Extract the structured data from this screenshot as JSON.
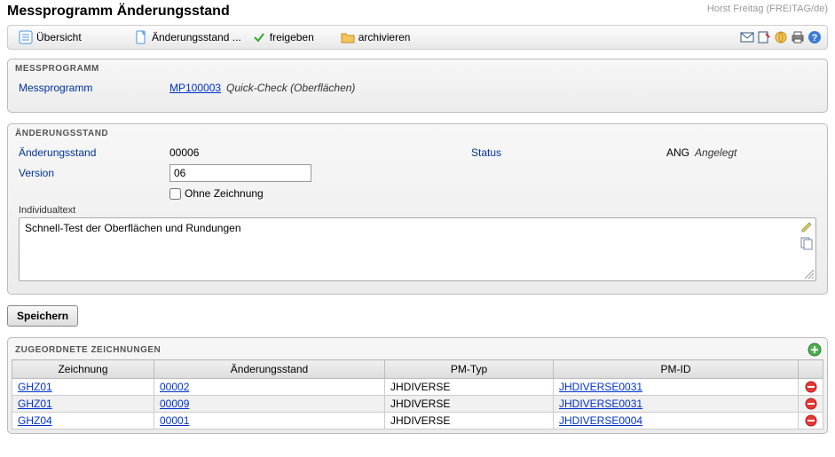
{
  "header": {
    "title": "Messprogramm Änderungsstand",
    "user": "Horst Freitag (FREITAG/de)"
  },
  "toolbar": {
    "overview": "Übersicht",
    "revision": "Änderungsstand ...",
    "release": "freigeben",
    "archive": "archivieren"
  },
  "messprogramm_panel": {
    "title": "MESSPROGRAMM",
    "label": "Messprogramm",
    "link": "MP100003",
    "desc": "Quick-Check (Oberflächen)"
  },
  "revision_panel": {
    "title": "ÄNDERUNGSSTAND",
    "rev_label": "Änderungsstand",
    "rev_value": "00006",
    "status_label": "Status",
    "status_code": "ANG",
    "status_text": "Angelegt",
    "version_label": "Version",
    "version_value": "06",
    "no_drawing_label": "Ohne Zeichnung",
    "individual_label": "Individualtext",
    "individual_text": "Schnell-Test der Oberflächen und Rundungen"
  },
  "save_button": "Speichern",
  "drawings_panel": {
    "title": "ZUGEORDNETE ZEICHNUNGEN",
    "columns": {
      "drawing": "Zeichnung",
      "revision": "Änderungsstand",
      "pmtype": "PM-Typ",
      "pmid": "PM-ID"
    },
    "rows": [
      {
        "drawing": "GHZ01",
        "revision": "00002",
        "pmtype": "JHDIVERSE",
        "pmid": "JHDIVERSE0031"
      },
      {
        "drawing": "GHZ01",
        "revision": "00009",
        "pmtype": "JHDIVERSE",
        "pmid": "JHDIVERSE0031"
      },
      {
        "drawing": "GHZ04",
        "revision": "00001",
        "pmtype": "JHDIVERSE",
        "pmid": "JHDIVERSE0004"
      }
    ]
  }
}
